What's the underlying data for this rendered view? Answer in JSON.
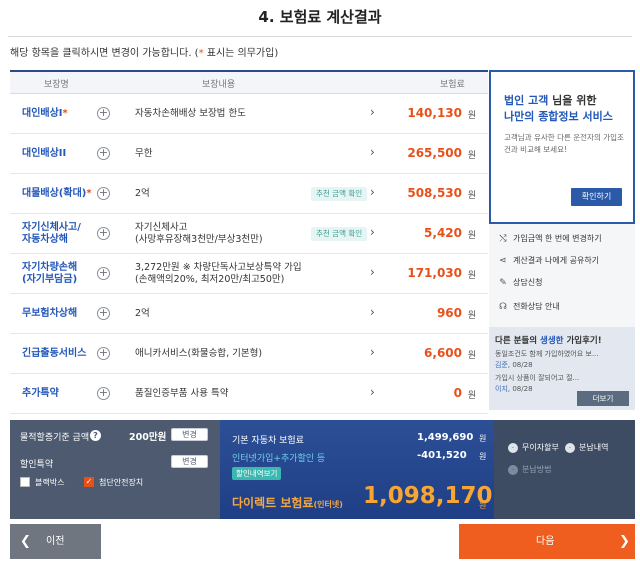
{
  "page": {
    "title": "4. 보험료 계산결과",
    "notice_prefix": "해당 항목을 클릭하시면 변경이 가능합니다. (",
    "notice_star": "*",
    "notice_suffix": " 표시는 의무가입)"
  },
  "table": {
    "headers": [
      "보장명",
      "보장내용",
      "보험료"
    ],
    "currency": "원",
    "rows": [
      {
        "name": "대인배상I",
        "required": true,
        "content": [
          "자동차손해배상 보장법 한도"
        ],
        "tag": "",
        "amount": "140,130"
      },
      {
        "name": "대인배상II",
        "required": false,
        "content": [
          "무한"
        ],
        "tag": "",
        "amount": "265,500"
      },
      {
        "name": "대물배상(확대)",
        "required": true,
        "content": [
          "2억"
        ],
        "tag": "추천 금액 확인",
        "amount": "508,530"
      },
      {
        "name": "자기신체사고/\n자동차상해",
        "required": false,
        "content": [
          "자기신체사고",
          "(사망후유장해3천만/부상3천만)"
        ],
        "tag": "추천 금액 확인",
        "amount": "5,420"
      },
      {
        "name": "자기차량손해\n(자기부담금)",
        "required": false,
        "content": [
          "3,272만원 ※ 차량단독사고보상특약 가입",
          "(손해액의20%, 최저20만/최고50만)"
        ],
        "tag": "",
        "amount": "171,030"
      },
      {
        "name": "무보험차상해",
        "required": false,
        "content": [
          "2억"
        ],
        "tag": "",
        "amount": "960"
      },
      {
        "name": "긴급출동서비스",
        "required": false,
        "content": [
          "애니카서비스(화물승합, 기본형)"
        ],
        "tag": "",
        "amount": "6,600"
      },
      {
        "name": "추가특약",
        "required": false,
        "content": [
          "품질인증부품 사용 특약"
        ],
        "tag": "",
        "amount": "0"
      }
    ]
  },
  "side": {
    "ad_line1_blue": "법인 고객",
    "ad_line1_plain": " 님을 위한",
    "ad_line2": "나만의 종합정보 서비스",
    "ad_desc": "고객님과 유사한 다른 운전자의 가입조건과 비교해 보세요!",
    "ad_button": "확인하기",
    "menu": [
      {
        "icon": "shuffle-icon",
        "glyph": "⤭",
        "label": "가입금액 한 번에 변경하기"
      },
      {
        "icon": "share-icon",
        "glyph": "⋖",
        "label": "계산결과 나에게 공유하기"
      },
      {
        "icon": "edit-icon",
        "glyph": "✎",
        "label": "상담신청"
      },
      {
        "icon": "headset-icon",
        "glyph": "☊",
        "label": "전화상담 안내"
      }
    ],
    "reviews_title_prefix": "다른 분들의 ",
    "reviews_title_em": "생생한",
    "reviews_title_suffix": " 가입후기!",
    "reviews": [
      {
        "text": "동일조건도 함께 가입하였어요 보...",
        "by": "김준",
        "date": "08/28"
      },
      {
        "text": "가입시 상품이 잘되어고 절...",
        "by": "이지",
        "date": "08/28"
      }
    ],
    "reviews_more": "더보기"
  },
  "bottom": {
    "property_label": "물적할증기준 금액",
    "property_value": "200만원",
    "change_label": "변경",
    "discount_label": "할인특약",
    "checkbox1": "블랙박스",
    "checkbox2": "첨단안전장치",
    "base_label": "기본 자동차 보험료",
    "base_value": "1,499,690",
    "discount_line": "인터넷가입+추가할인 등",
    "discount_value": "-401,520",
    "detail_button": "할인내역보기",
    "final_label": "다이렉트 보험료",
    "final_small": "(인터넷)",
    "final_value": "1,098,170",
    "won": "원",
    "option1": "무이자할부",
    "option2": "분납내역",
    "option3": "분납방법"
  },
  "nav": {
    "prev": "이전",
    "next": "다음"
  },
  "colors": {
    "accent_orange": "#e8501a",
    "brand_blue": "#2458b8",
    "next_button": "#ef5e1f"
  }
}
